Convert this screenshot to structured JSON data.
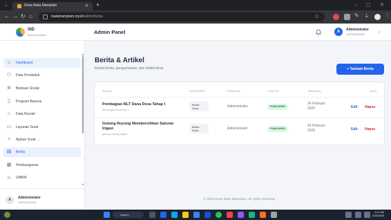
{
  "browser": {
    "tab_title": "Desa Mata Mamplam",
    "url_host": "matamamplam.my.id",
    "url_path": "/admin/berita"
  },
  "header": {
    "brand_name": "SID",
    "brand_sub": "Mata Mamplam",
    "page_title": "Admin Panel",
    "user_initial": "A",
    "user_name": "Administrator",
    "user_role": "SUPERADMIN"
  },
  "sidebar": {
    "items": [
      {
        "label": "Dashboard",
        "icon": "home-icon"
      },
      {
        "label": "Data Penduduk",
        "icon": "users-icon"
      },
      {
        "label": "Bantuan Sosial",
        "icon": "gift-icon"
      },
      {
        "label": "Program Bansos",
        "icon": "clipboard-icon"
      },
      {
        "label": "Data Rumah",
        "icon": "house-icon"
      },
      {
        "label": "Layanan Surat",
        "icon": "file-icon"
      },
      {
        "label": "Ajukan Surat →",
        "icon": "plus-icon"
      },
      {
        "label": "Berita",
        "icon": "news-icon"
      },
      {
        "label": "Pembangunan",
        "icon": "building-icon"
      },
      {
        "label": "UMKM",
        "icon": "shop-icon"
      }
    ],
    "footer_initial": "A",
    "footer_name": "Administrator",
    "footer_role": "SUPERADMIN"
  },
  "main": {
    "title": "Berita & Artikel",
    "subtitle": "Kelola berita, pengumuman, dan artikel desa",
    "add_button": "+ Tambah Berita",
    "columns": [
      "JUDUL",
      "KATEGORI",
      "PENULIS",
      "STATUS",
      "TANGGAL",
      "AKSI"
    ],
    "rows": [
      {
        "title": "Pembagian BLT Dana Desa Tahap I",
        "slug": "pembagian-blt-tahap-1",
        "category": "Berita Desa",
        "author": "Administrator",
        "status": "PUBLISHED",
        "date": "24 Februari 2026",
        "edit": "Edit",
        "delete": "Hapus"
      },
      {
        "title": "Gotong Royong Membersihkan Saluran Irigasi",
        "slug": "gotong-royong-irigasi",
        "category": "Berita Desa",
        "author": "Administrator",
        "status": "PUBLISHED",
        "date": "24 Februari 2026",
        "edit": "Edit",
        "delete": "Hapus"
      }
    ],
    "footer": "© 2026 Desa Mata Mamplam. All rights reserved."
  },
  "taskbar": {
    "search_label": "Search",
    "time": "1:47 AM",
    "date": "2/25/2026"
  },
  "colors": {
    "accent": "#2563eb",
    "danger": "#dc2626",
    "success_bg": "#dcf5e3",
    "success_text": "#15803d"
  }
}
